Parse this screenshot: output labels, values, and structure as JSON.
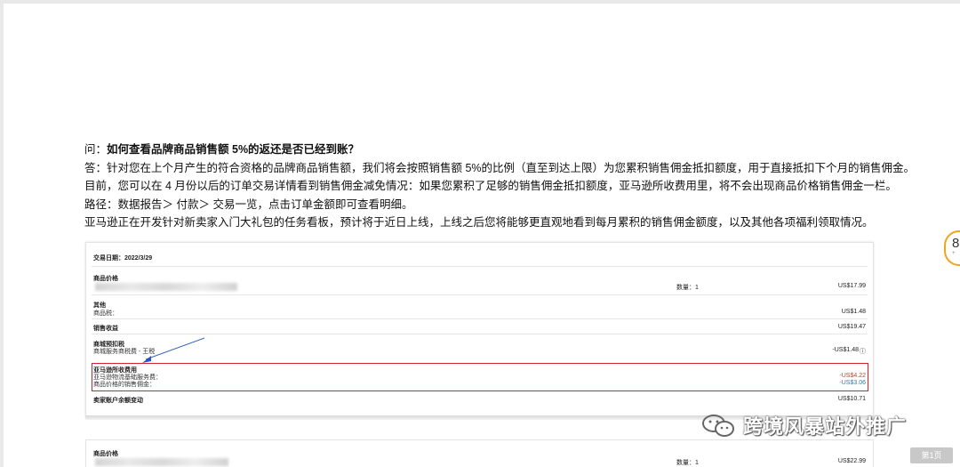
{
  "article": {
    "question_prefix": "问：",
    "question": "如何查看品牌商品销售额 5%的返还是否已经到账？",
    "answer": "答：针对您在上个月产生的符合资格的品牌商品销售额，我们将会按照销售额 5%的比例（直至到达上限）为您累积销售佣金抵扣额度，用于直接抵扣下个月的销售佣金。",
    "current": "目前，您可以在 4 月份以后的订单交易详情看到销售佣金减免情况：如果您累积了足够的销售佣金抵扣额度，亚马逊所收费用里，将不会出现商品价格销售佣金一栏。",
    "path": "路径：数据报告＞ 付款＞ 交易一览，点击订单金额即可查看明细。",
    "future": "亚马逊正在开发针对新卖家入门大礼包的任务看板，预计将于近日上线，上线之后您将能够更直观地看到每月累积的销售佣金额度，以及其他各项福利领取情况。"
  },
  "card": {
    "date": "交易日期：2022/3/29",
    "product_price_label": "商品价格",
    "quantity": "数量：1",
    "product_price": "US$17.99",
    "other_label": "其他",
    "product_tax_label": "商品税：",
    "product_tax": "US$1.48",
    "sales_revenue_label": "销售收益",
    "sales_revenue": "US$19.47",
    "withholding_label": "商城预扣税",
    "withholding_sub": "商城服务商税费 - 王税",
    "withholding": "-US$1.48",
    "fees_label": "亚马逊所收费用",
    "fba_fee_label": "亚马逊物流基础服务费：",
    "fba_fee": "-US$4.22",
    "commission_label": "商品价格的销售佣金：",
    "commission": "-US$3.06",
    "balance_label": "卖家账户余额变动",
    "balance": "US$10.71"
  },
  "card2": {
    "product_price_label": "商品价格",
    "quantity": "数量：1",
    "product_price": "US$22.99"
  },
  "badge": {
    "number": "8",
    "sub": "+"
  },
  "watermark": {
    "text": "跨境风暴站外推广"
  },
  "pager": {
    "next": "第1页"
  },
  "colors": {
    "highlight_border": "#d6222a",
    "fee_red": "#d03b2a",
    "fee_blue": "#2a7fa8",
    "badge_ring": "#f0a51c"
  }
}
